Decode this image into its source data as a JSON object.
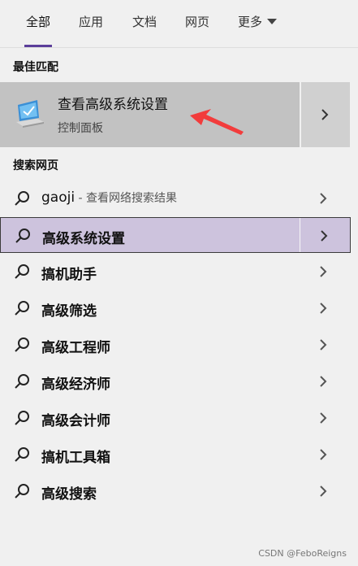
{
  "tabs": [
    {
      "label": "全部"
    },
    {
      "label": "应用"
    },
    {
      "label": "文档"
    },
    {
      "label": "网页"
    },
    {
      "label": "更多"
    }
  ],
  "best_match": {
    "section_label": "最佳匹配",
    "title": "查看高级系统设置",
    "subtitle": "控制面板",
    "icon": "system-settings-monitor-icon"
  },
  "web_search": {
    "section_label": "搜索网页",
    "query_row": {
      "query": "gaoji",
      "hint": " - 查看网络搜索结果"
    },
    "suggestions": [
      {
        "label": "高级系统设置"
      },
      {
        "label": "搞机助手"
      },
      {
        "label": "高级筛选"
      },
      {
        "label": "高级工程师"
      },
      {
        "label": "高级经济师"
      },
      {
        "label": "高级会计师"
      },
      {
        "label": "搞机工具箱"
      },
      {
        "label": "高级搜索"
      }
    ]
  },
  "watermark": "CSDN @FeboReigns",
  "colors": {
    "accent": "#5b3e9a",
    "selected_row": "#cdc3dd",
    "best_match_bg": "#c2c2c2",
    "annotation_arrow": "#f23c3c"
  }
}
